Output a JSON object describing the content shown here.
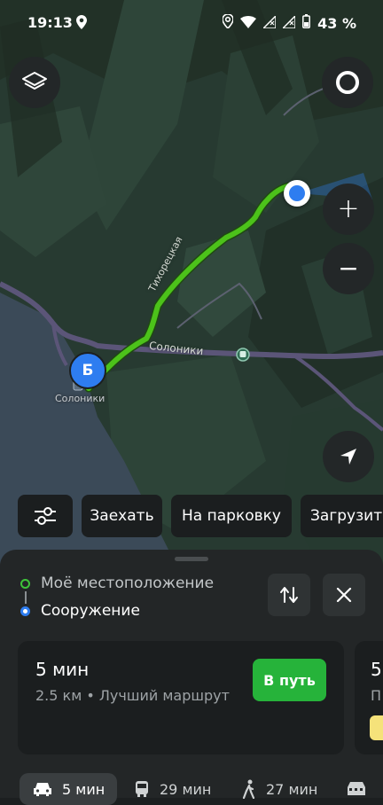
{
  "status_bar": {
    "time": "19:13",
    "battery": "43 %"
  },
  "map": {
    "street_label": "Тихорецкая",
    "road_label": "Солоники",
    "place_label": "Солоники",
    "destination_marker": "Б"
  },
  "controls": {
    "zoom_in": "+",
    "zoom_out": "−"
  },
  "chips": [
    {
      "label": "Заехать"
    },
    {
      "label": "На парковку"
    },
    {
      "label": "Загрузить"
    }
  ],
  "waypoints": {
    "from": "Моё местоположение",
    "to": "Сооружение"
  },
  "route_card": {
    "time": "5 мин",
    "details": "2.5 км • Лучший маршрут",
    "go_label": "В путь"
  },
  "route_card_next": {
    "time_prefix": "5",
    "details_prefix": "П"
  },
  "transport_tabs": [
    {
      "label": "5 мин",
      "icon": "car-icon"
    },
    {
      "label": "29 мин",
      "icon": "bus-icon"
    },
    {
      "label": "27 мин",
      "icon": "walk-icon"
    },
    {
      "label": "",
      "icon": "taxi-icon"
    }
  ],
  "colors": {
    "route": "#4cc21a",
    "accent_blue": "#2e7df0",
    "go_button": "#26b33a",
    "waypoint_from": "#3ec43a"
  }
}
